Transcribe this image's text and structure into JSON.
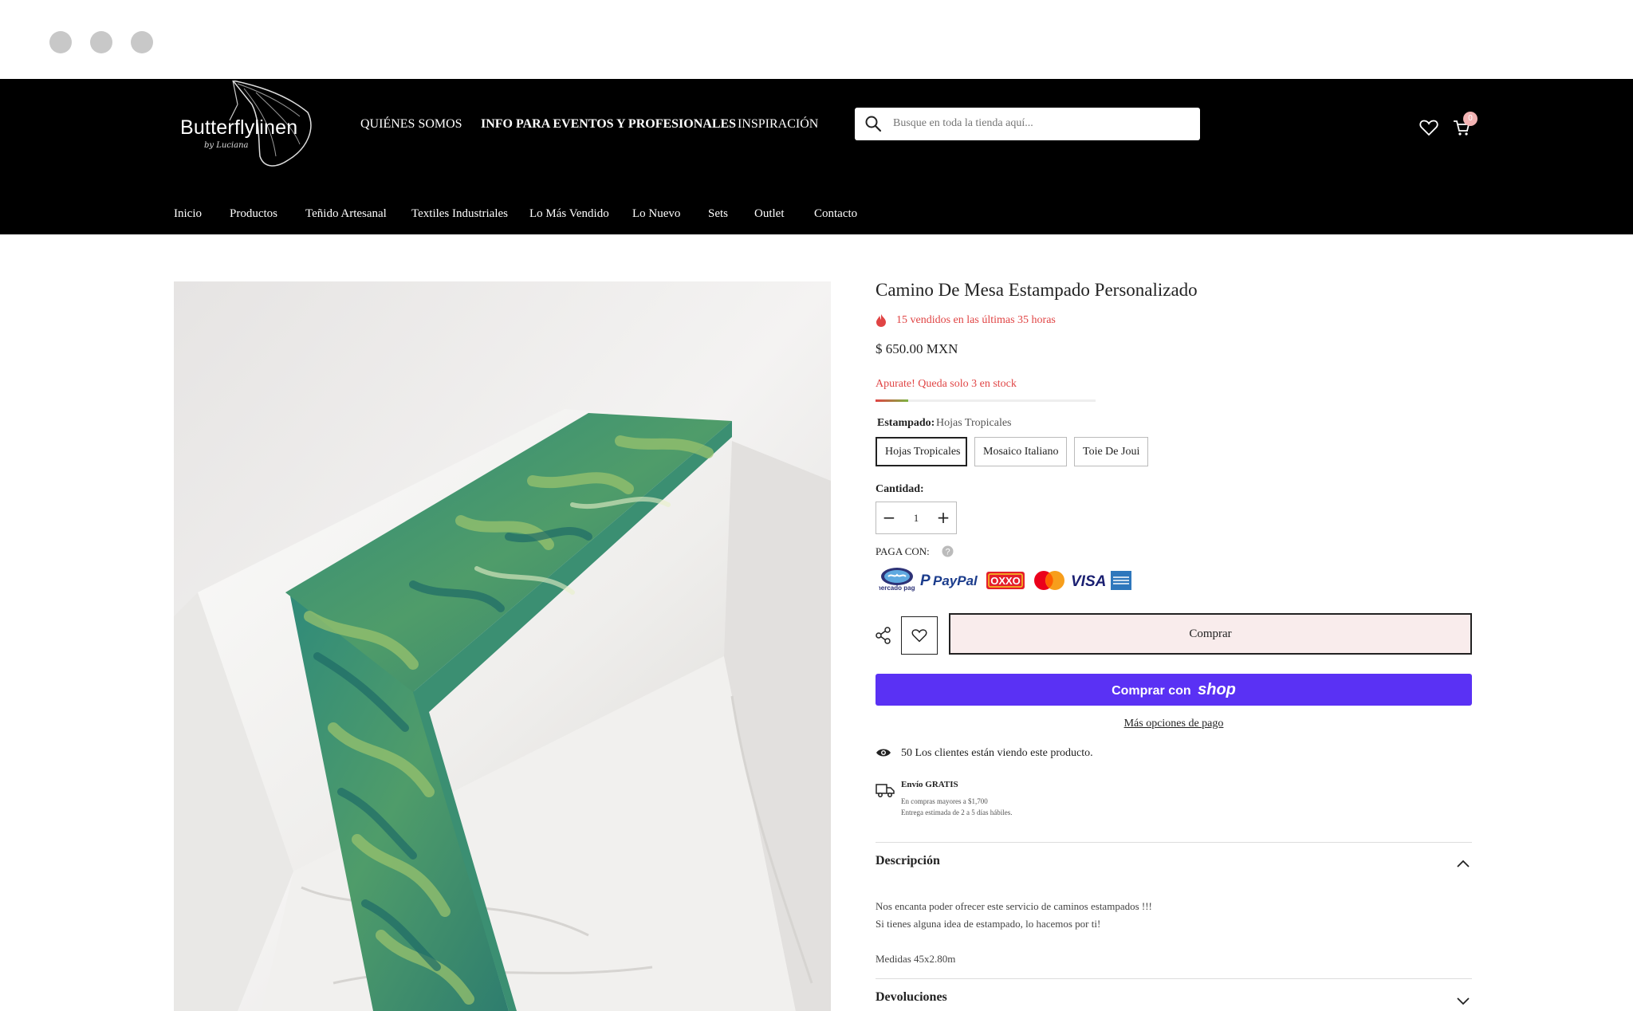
{
  "header": {
    "logo_text": "Butterflylinen",
    "logo_sub": "by Luciana",
    "top_links": [
      "QUIÉNES SOMOS",
      "INFO PARA EVENTOS Y PROFESIONALES",
      "INSPIRACIÓN"
    ],
    "search_placeholder": "Busque en toda la tienda aquí...",
    "cart_count": "0",
    "nav": [
      "Inicio",
      "Productos",
      "Teñido Artesanal",
      "Textiles Industriales",
      "Lo Más Vendido",
      "Lo Nuevo",
      "Sets",
      "Outlet",
      "Contacto"
    ]
  },
  "product": {
    "title": "Camino De Mesa Estampado Personalizado",
    "sold_text": "15 vendidos en las últimas 35 horas",
    "price": "$ 650.00 MXN",
    "stock_text": "Apurate! Queda solo 3 en stock",
    "stock_level": 0.15,
    "pattern_label": "Estampado:",
    "pattern_selected": "Hojas Tropicales",
    "patterns": [
      "Hojas Tropicales",
      "Mosaico Italiano",
      "Toie De Joui"
    ],
    "quantity_label": "Cantidad:",
    "quantity": "1",
    "pay_label": "PAGA CON:",
    "payments": [
      "mercado pago",
      "PayPal",
      "OXXO",
      "mastercard",
      "VISA",
      "AMEX"
    ],
    "buy_label": "Comprar",
    "shop_label": "Comprar con",
    "shop_brand": "shop",
    "more_options": "Más opciones de pago",
    "viewing_text": "50 Los clientes están viendo este producto.",
    "shipping_title": "Envío GRATIS",
    "shipping_line1": "En compras mayores a $1,700",
    "shipping_line2": "Entrega estimada de 2 a 5 días hábiles.",
    "description_title": "Descripción",
    "description_lines": [
      "Nos encanta poder ofrecer este servicio de caminos estampados !!!",
      "Si tienes alguna idea de estampado, lo hacemos por ti!"
    ],
    "measures": "Medidas 45x2.80m",
    "returns_title": "Devoluciones"
  },
  "colors": {
    "header_bg": "#000000",
    "accent_red": "#e04444",
    "shop_purple": "#5a31f4",
    "buy_bg": "#f9ecec"
  }
}
